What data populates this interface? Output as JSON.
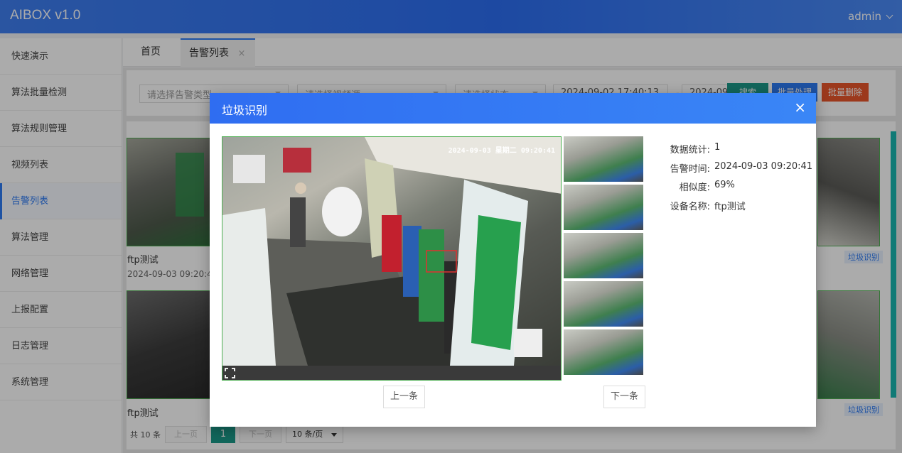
{
  "app": {
    "title": "AIBOX v1.0",
    "user": "admin"
  },
  "sidebar": {
    "items": [
      {
        "label": "快速演示"
      },
      {
        "label": "算法批量检测"
      },
      {
        "label": "算法规则管理"
      },
      {
        "label": "视频列表"
      },
      {
        "label": "告警列表"
      },
      {
        "label": "算法管理"
      },
      {
        "label": "网络管理"
      },
      {
        "label": "上报配置"
      },
      {
        "label": "日志管理"
      },
      {
        "label": "系统管理"
      }
    ],
    "active_index": 4
  },
  "tabs": {
    "home": "首页",
    "alarm_list": "告警列表",
    "close": "×"
  },
  "filters": {
    "alarm_type_placeholder": "请选择告警类型",
    "video_source_placeholder": "请选择视频源",
    "status_placeholder": "请选择状态",
    "start_time": "2024-09-02 17:40:13",
    "end_time": "2024-09-",
    "separator": "-",
    "search_label": "搜索",
    "batch_process_label": "批量处理",
    "batch_delete_label": "批量删除"
  },
  "cards": [
    {
      "title": "ftp测试",
      "time": "2024-09-03 09:20:41"
    },
    {
      "title": "ftp测试"
    }
  ],
  "tags": [
    "垃圾识别",
    "垃圾识别"
  ],
  "pagination": {
    "total": "共 10 条",
    "prev": "上一页",
    "page": "1",
    "next": "下一页",
    "page_size": "10 条/页"
  },
  "modal": {
    "title": "垃圾识别",
    "close": "×",
    "osd_text": "2024-09-03 星期二 09:20:41",
    "prev_label": "上一条",
    "next_label": "下一条",
    "info": {
      "count_label": "数据统计:",
      "count_value": "1",
      "time_label": "告警时间:",
      "time_value": "2024-09-03 09:20:41",
      "similarity_label": "相似度:",
      "similarity_value": "69%",
      "device_label": "设备名称:",
      "device_value": "ftp测试"
    }
  },
  "colors": {
    "accent": "#2d7bf4",
    "search": "#1b9a8a",
    "batch_process": "#2d7bf4",
    "batch_delete": "#e9552a"
  }
}
